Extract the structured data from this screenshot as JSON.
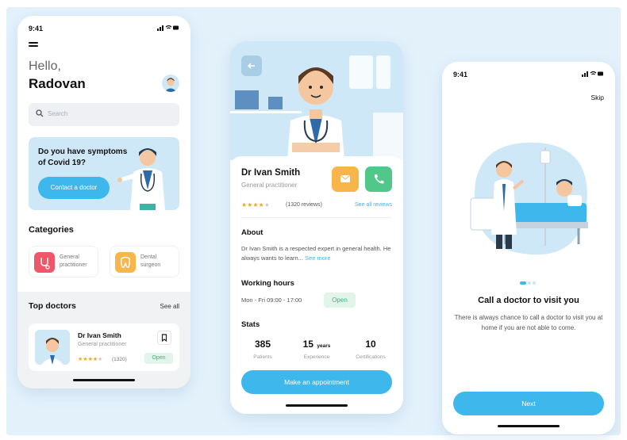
{
  "colors": {
    "background": "#e3f1fb",
    "accent": "#3eb7ec",
    "open_green": "#3fb27f",
    "star": "#f5a623",
    "mail": "#f7b54a",
    "call": "#4fc88a",
    "category_gp": "#f0566a",
    "category_dental": "#f7b54a"
  },
  "home": {
    "status_time": "9:41",
    "status_icons": "signal wifi battery",
    "menu_icon": "hamburger-icon",
    "greeting": "Hello,",
    "user_name": "Radovan",
    "search_placeholder": "Search",
    "banner": {
      "question": "Do you have symptoms of Covid 19?",
      "button": "Contact a doctor"
    },
    "categories_title": "Categories",
    "categories": [
      {
        "label": "General practitioner",
        "icon": "stethoscope-icon"
      },
      {
        "label": "Dental surgeon",
        "icon": "tooth-icon"
      }
    ],
    "top_doctors_title": "Top doctors",
    "see_all": "See all",
    "doctor_card": {
      "name": "Dr Ivan Smith",
      "specialty": "General practitioner",
      "stars": "★★★★★",
      "rating": 4,
      "reviews": "(1320)",
      "status": "Open"
    }
  },
  "profile": {
    "back_icon": "arrow-left-icon",
    "name": "Dr Ivan Smith",
    "specialty": "General practitioner",
    "stars": "★★★★★",
    "rating": 4,
    "reviews": "(1320 reviews)",
    "see_all_reviews": "See all reviews",
    "about_title": "About",
    "about_text": "Dr Ivan Smith is a respected expert in general health. He always wants to learn...",
    "see_more": "See more",
    "working_hours_title": "Working hours",
    "working_hours": "Mon - Fri 09:00 - 17:00",
    "status": "Open",
    "stats_title": "Stats",
    "stats": [
      {
        "value": "385",
        "unit": "",
        "label": "Patients"
      },
      {
        "value": "15",
        "unit": "years",
        "label": "Experience"
      },
      {
        "value": "10",
        "unit": "",
        "label": "Certifications"
      }
    ],
    "cta": "Make an appointment"
  },
  "onboarding": {
    "status_time": "9:41",
    "skip": "Skip",
    "title": "Call a doctor to visit you",
    "text": "There is always chance to call a doctor to visit you at home if you are not able to come.",
    "next": "Next"
  }
}
